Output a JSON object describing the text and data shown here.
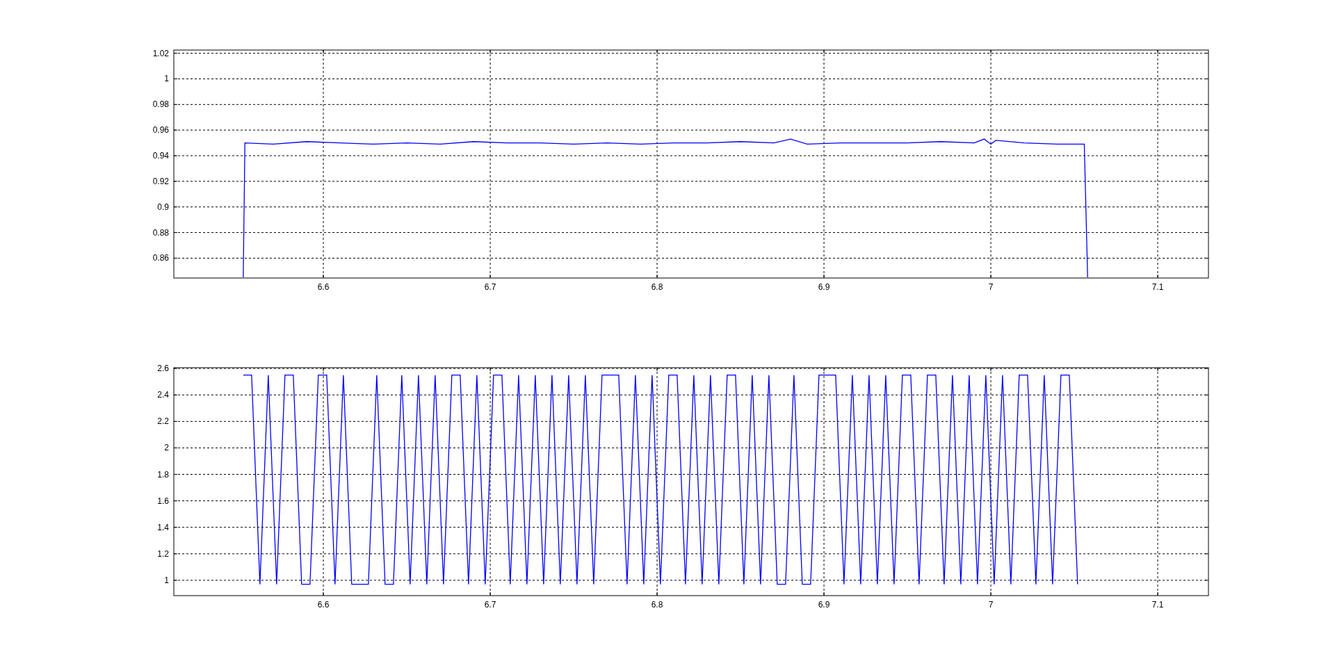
{
  "figure": {
    "plots": [
      {
        "chart_data": {
          "type": "line",
          "grid": true,
          "xlim": [
            6.5104,
            7.1304
          ],
          "ylim": [
            0.8445,
            1.0225
          ],
          "xticks": [
            6.6,
            6.7,
            6.8,
            6.9,
            {
              "value": 7,
              "label": "7"
            },
            7.1
          ],
          "yticks": [
            0.86,
            0.88,
            {
              "value": 0.9,
              "label": "0.9"
            },
            0.92,
            0.94,
            0.96,
            0.98,
            {
              "value": 1,
              "label": "1"
            },
            1.02
          ],
          "series": [
            {
              "color": "#0000ff",
              "x": [
                6.552,
                6.553,
                6.57,
                6.59,
                6.61,
                6.63,
                6.65,
                6.67,
                6.69,
                6.71,
                6.73,
                6.75,
                6.77,
                6.79,
                6.81,
                6.83,
                6.85,
                6.87,
                6.88,
                6.89,
                6.91,
                6.93,
                6.95,
                6.97,
                6.99,
                6.996,
                7.0,
                7.003,
                7.02,
                7.04,
                7.056,
                7.058
              ],
              "values": [
                0.845,
                0.95,
                0.949,
                0.951,
                0.95,
                0.949,
                0.95,
                0.949,
                0.951,
                0.95,
                0.95,
                0.949,
                0.95,
                0.949,
                0.95,
                0.95,
                0.951,
                0.95,
                0.953,
                0.949,
                0.95,
                0.95,
                0.95,
                0.951,
                0.95,
                0.953,
                0.949,
                0.952,
                0.95,
                0.949,
                0.949,
                0.845
              ]
            }
          ]
        }
      },
      {
        "chart_data": {
          "type": "line",
          "grid": true,
          "xlim": [
            6.5104,
            7.1304
          ],
          "ylim": [
            0.884,
            2.606
          ],
          "xticks": [
            6.6,
            6.7,
            6.8,
            6.9,
            {
              "value": 7,
              "label": "7"
            },
            7.1
          ],
          "yticks": [
            {
              "value": 1,
              "label": "1"
            },
            1.2,
            1.4,
            1.6,
            1.8,
            {
              "value": 2,
              "label": "2"
            },
            2.2,
            2.4,
            2.6
          ],
          "series": [
            {
              "color": "#0000ff",
              "x": [
                6.552,
                6.557,
                6.562,
                6.567,
                6.572,
                6.577,
                6.582,
                6.587,
                6.592,
                6.597,
                6.602,
                6.607,
                6.612,
                6.617,
                6.622,
                6.627,
                6.632,
                6.637,
                6.642,
                6.647,
                6.652,
                6.657,
                6.662,
                6.667,
                6.672,
                6.677,
                6.682,
                6.687,
                6.692,
                6.697,
                6.702,
                6.707,
                6.712,
                6.717,
                6.722,
                6.727,
                6.732,
                6.737,
                6.742,
                6.747,
                6.752,
                6.757,
                6.762,
                6.767,
                6.772,
                6.777,
                6.782,
                6.787,
                6.792,
                6.797,
                6.802,
                6.807,
                6.812,
                6.817,
                6.822,
                6.827,
                6.832,
                6.837,
                6.842,
                6.847,
                6.852,
                6.857,
                6.862,
                6.867,
                6.872,
                6.877,
                6.882,
                6.887,
                6.892,
                6.897,
                6.902,
                6.907,
                6.912,
                6.917,
                6.922,
                6.927,
                6.932,
                6.937,
                6.942,
                6.947,
                6.952,
                6.957,
                6.962,
                6.967,
                6.972,
                6.977,
                6.982,
                6.987,
                6.992,
                6.997,
                7.002,
                7.007,
                7.012,
                7.017,
                7.022,
                7.027,
                7.032,
                7.037,
                7.042,
                7.047,
                7.052
              ],
              "values": [
                2.55,
                2.55,
                0.97,
                2.55,
                0.97,
                2.55,
                2.55,
                0.97,
                0.97,
                2.55,
                2.55,
                0.97,
                2.55,
                0.97,
                0.97,
                0.97,
                2.55,
                0.97,
                0.97,
                2.55,
                0.97,
                2.55,
                0.97,
                2.55,
                0.97,
                2.55,
                2.55,
                0.97,
                2.55,
                0.97,
                2.55,
                2.55,
                0.97,
                2.55,
                0.97,
                2.55,
                0.97,
                2.55,
                0.97,
                2.55,
                0.97,
                2.55,
                0.97,
                2.55,
                2.55,
                2.55,
                0.97,
                2.55,
                0.97,
                2.55,
                0.97,
                2.55,
                2.55,
                0.97,
                2.55,
                0.97,
                2.55,
                0.97,
                2.55,
                2.55,
                0.97,
                2.55,
                0.97,
                2.55,
                0.97,
                0.97,
                2.55,
                0.97,
                0.97,
                2.55,
                2.55,
                2.55,
                0.97,
                2.55,
                0.97,
                2.55,
                0.97,
                2.55,
                0.97,
                2.55,
                2.55,
                0.97,
                2.55,
                2.55,
                0.97,
                2.55,
                0.97,
                2.55,
                0.97,
                2.55,
                0.97,
                2.55,
                0.97,
                2.55,
                2.55,
                0.97,
                2.55,
                0.97,
                2.55,
                2.55,
                0.97
              ]
            }
          ]
        }
      }
    ]
  }
}
